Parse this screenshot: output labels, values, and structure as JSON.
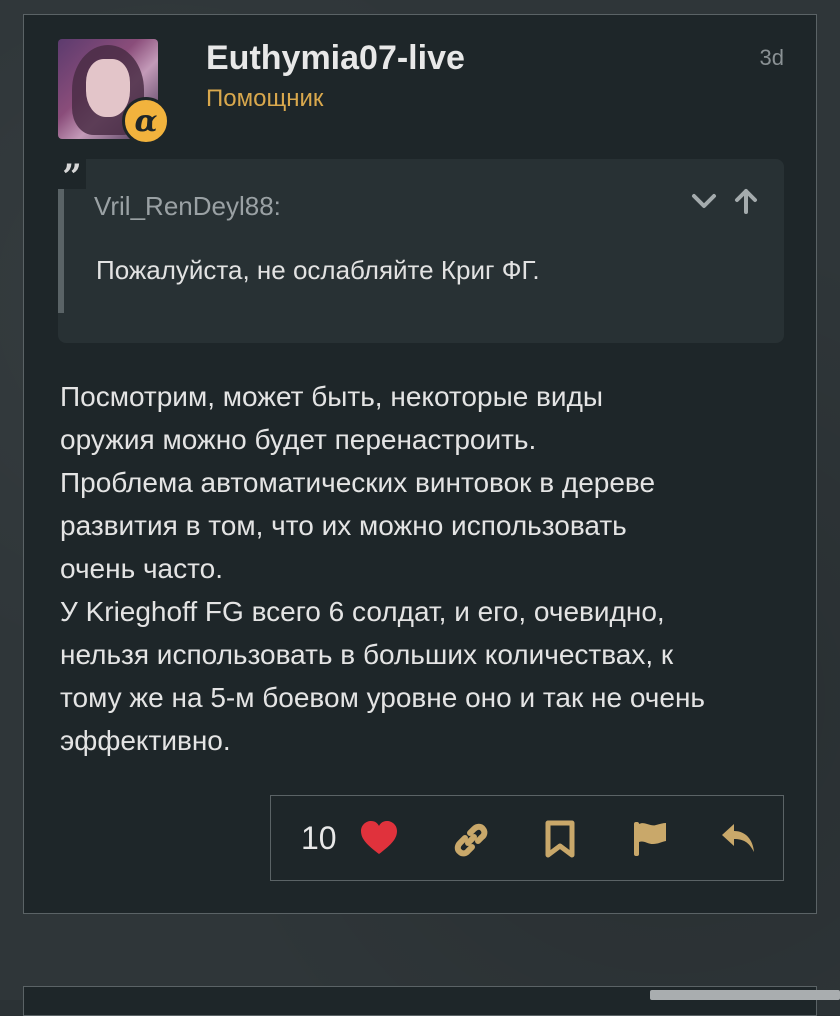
{
  "post": {
    "username": "Euthymia07-live",
    "user_title": "Помощник",
    "date": "3d",
    "badge_icon": "alpha-badge-icon",
    "quote": {
      "author": "Vril_RenDeyl88:",
      "text": "Пожалуйста, не ослабляйте Криг ФГ."
    },
    "body_lines": [
      "Посмотрим, может быть, некоторые виды",
      "оружия можно будет перенастроить.",
      "Проблема автоматических винтовок в дереве",
      "развития в том, что их можно использовать",
      "очень часто.",
      "У Krieghoff FG всего 6 солдат, и его, очевидно,",
      "нельзя использовать в больших количествах, к",
      "тому же на 5-м боевом уровне оно и так не очень",
      "эффективно."
    ],
    "like_count": "10"
  },
  "colors": {
    "accent": "#d9a84d",
    "heart": "#e0323c",
    "action_icon": "#c9a86a",
    "badge": "#f2b33d"
  }
}
